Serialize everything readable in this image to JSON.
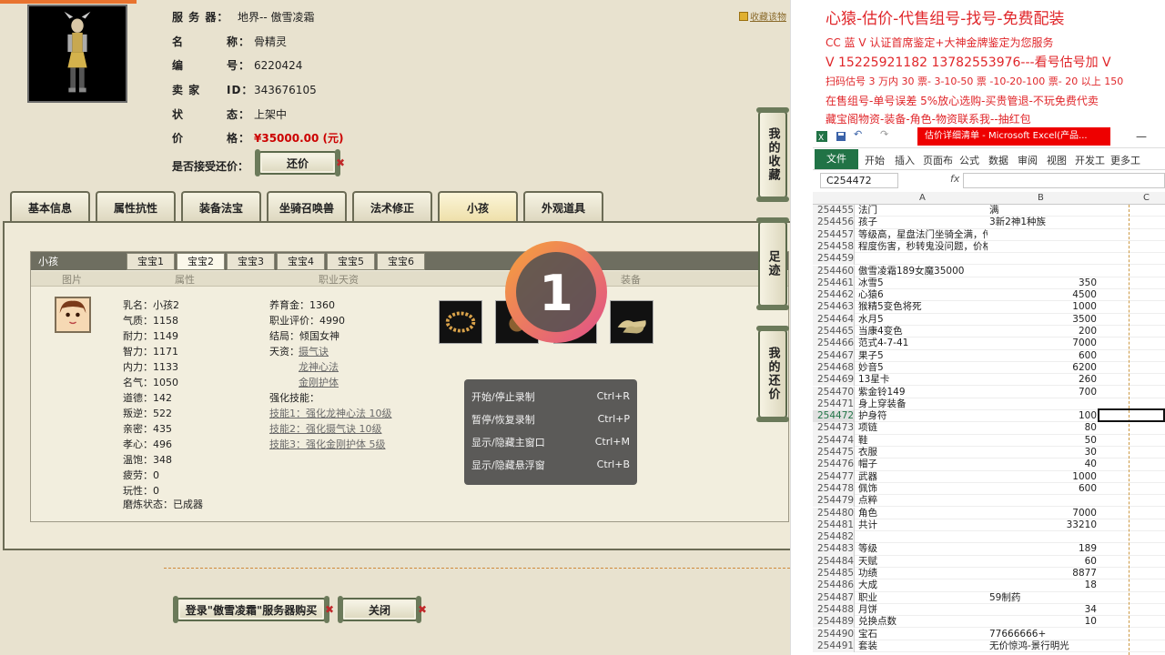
{
  "game": {
    "server_label": "服 务 器：",
    "server_value": "地界-- 傲雪凌霜",
    "name_label": "名",
    "name_label2": "称：",
    "name_value": "骨精灵",
    "id_label": "编",
    "id_label2": "号：",
    "id_value": "6220424",
    "seller_label": "卖 家",
    "seller_label2": "ID：",
    "seller_value": "343676105",
    "status_label": "状",
    "status_label2": "态：",
    "status_value": "上架中",
    "price_label": "价",
    "price_label2": "格：",
    "price_value": "¥35000.00 (元)",
    "bargain_label": "是否接受还价：",
    "bargain_button": "还价",
    "fav_link": "收藏该物",
    "tabs": [
      "基本信息",
      "属性抗性",
      "装备法宝",
      "坐骑召唤兽",
      "法术修正",
      "小孩",
      "外观道具"
    ],
    "panel_title": "小孩",
    "subtabs": [
      "宝宝1",
      "宝宝2",
      "宝宝3",
      "宝宝4",
      "宝宝5",
      "宝宝6"
    ],
    "col_heads": [
      "图片",
      "属性",
      "职业天资",
      "装备"
    ],
    "stats_left": [
      "乳名：小孩2",
      "气质：1158",
      "耐力：1149",
      "智力：1171",
      "内力：1133",
      "名气：1050",
      "道德：142",
      "叛逆：522",
      "亲密：435",
      "孝心：496",
      "温饱：348",
      "疲劳：0",
      "玩性：0",
      "磨炼状态：已成器"
    ],
    "stats_mid": [
      "养育金：1360",
      "职业评价：4990",
      "结局：倾国女神",
      "天资：",
      "强化技能："
    ],
    "talent_links": [
      "摄气诀",
      "龙神心法",
      "金刚护体"
    ],
    "skill_links": [
      "技能1：强化龙神心法 10级",
      "技能2：强化摄气诀 10级",
      "技能3：强化金刚护体 5级"
    ],
    "side_buttons": [
      "我的收藏",
      "足迹",
      "我的还价"
    ],
    "buy_button": "登录\"傲雪凌霜\"服务器购买",
    "close_button": "关闭"
  },
  "recorder": {
    "countdown": "1",
    "menu": [
      {
        "label": "开始/停止录制",
        "shortcut": "Ctrl+R"
      },
      {
        "label": "暂停/恢复录制",
        "shortcut": "Ctrl+P"
      },
      {
        "label": "显示/隐藏主窗口",
        "shortcut": "Ctrl+M"
      },
      {
        "label": "显示/隐藏悬浮窗",
        "shortcut": "Ctrl+B"
      }
    ]
  },
  "promo": {
    "line1": "心猿-估价-代售组号-找号-免费配装",
    "line2": "CC 蓝 V 认证首席鉴定+大神金牌鉴定为您服务",
    "line3": "V 15225921182     13782553976---看号估号加 V",
    "line4": "扫码估号 3 万内 30 票- 3-10-50 票  -10-20-100 票- 20 以上 150",
    "line5": "在售组号-单号误差 5%放心选购-买贵管退-不玩免费代卖",
    "line6": "藏宝阁物资-装备-角色-物资联系我--抽红包"
  },
  "excel": {
    "title": "估价详细清单 - Microsoft Excel(产品...",
    "ribbon_tabs": [
      "文件",
      "开始",
      "插入",
      "页面布",
      "公式",
      "数据",
      "审阅",
      "视图",
      "开发工",
      "更多工"
    ],
    "namebox": "C254472",
    "fx": "fx",
    "col_headers": [
      "A",
      "B",
      "C"
    ],
    "rows": [
      {
        "n": "254455",
        "a": "法门",
        "b": "满",
        "num": false
      },
      {
        "n": "254456",
        "a": "孩子",
        "b": "3新2神1种族",
        "num": false
      },
      {
        "n": "254457",
        "a": "等级高，星盘法门坐骑全满，传世异兽风克水",
        "b": "",
        "num": false
      },
      {
        "n": "254458",
        "a": "程度伤害，秒转鬼没问题，价格合适",
        "b": "",
        "num": false
      },
      {
        "n": "254459",
        "a": "",
        "b": "",
        "num": false
      },
      {
        "n": "254460",
        "a": "傲雪凌霜189女魔35000",
        "b": "",
        "num": false
      },
      {
        "n": "254461",
        "a": "冰雪5",
        "b": "350",
        "num": true
      },
      {
        "n": "254462",
        "a": "心猿6",
        "b": "4500",
        "num": true
      },
      {
        "n": "254463",
        "a": "猴精5变色将死",
        "b": "1000",
        "num": true
      },
      {
        "n": "254464",
        "a": "水月5",
        "b": "3500",
        "num": true
      },
      {
        "n": "254465",
        "a": "当康4变色",
        "b": "200",
        "num": true
      },
      {
        "n": "254466",
        "a": "范式4-7-41",
        "b": "7000",
        "num": true
      },
      {
        "n": "254467",
        "a": "果子5",
        "b": "600",
        "num": true
      },
      {
        "n": "254468",
        "a": "妙音5",
        "b": "6200",
        "num": true
      },
      {
        "n": "254469",
        "a": "13星卡",
        "b": "260",
        "num": true
      },
      {
        "n": "254470",
        "a": "紫金铃149",
        "b": "700",
        "num": true
      },
      {
        "n": "254471",
        "a": "身上穿装备",
        "b": "",
        "num": false
      },
      {
        "n": "254472",
        "a": "护身符",
        "b": "100",
        "num": true
      },
      {
        "n": "254473",
        "a": "项链",
        "b": "80",
        "num": true
      },
      {
        "n": "254474",
        "a": "鞋",
        "b": "50",
        "num": true
      },
      {
        "n": "254475",
        "a": "衣服",
        "b": "30",
        "num": true
      },
      {
        "n": "254476",
        "a": "帽子",
        "b": "40",
        "num": true
      },
      {
        "n": "254477",
        "a": "武器",
        "b": "1000",
        "num": true
      },
      {
        "n": "254478",
        "a": "佩饰",
        "b": "600",
        "num": true
      },
      {
        "n": "254479",
        "a": "点粹",
        "b": "",
        "num": false
      },
      {
        "n": "254480",
        "a": "角色",
        "b": "7000",
        "num": true
      },
      {
        "n": "254481",
        "a": "共计",
        "b": "33210",
        "num": true
      },
      {
        "n": "254482",
        "a": "",
        "b": "",
        "num": false
      },
      {
        "n": "254483",
        "a": "等级",
        "b": "189",
        "num": true
      },
      {
        "n": "254484",
        "a": "天赋",
        "b": "60",
        "num": true
      },
      {
        "n": "254485",
        "a": "功绩",
        "b": "8877",
        "num": true
      },
      {
        "n": "254486",
        "a": "大成",
        "b": "18",
        "num": true
      },
      {
        "n": "254487",
        "a": "职业",
        "b": "59制药",
        "num": false
      },
      {
        "n": "254488",
        "a": "月饼",
        "b": "34",
        "num": true
      },
      {
        "n": "254489",
        "a": "兑换点数",
        "b": "10",
        "num": true
      },
      {
        "n": "254490",
        "a": "宝石",
        "b": "77666666+",
        "num": false
      },
      {
        "n": "254491",
        "a": "套装",
        "b": "无价惊鸿-景行明光",
        "num": false
      }
    ]
  },
  "colors": {
    "accent_red": "#e0262a",
    "excel_green": "#217346",
    "price_red": "#cc0000"
  }
}
